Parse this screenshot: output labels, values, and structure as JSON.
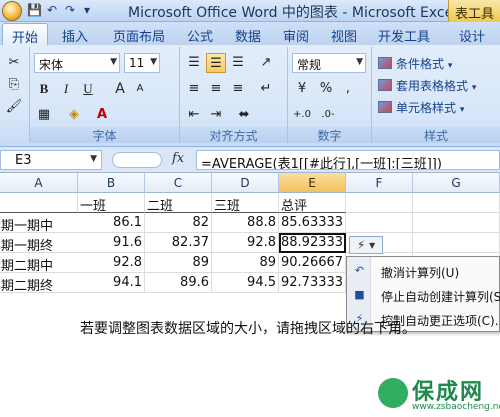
{
  "window": {
    "title": "Microsoft Office Word 中的图表 - Microsoft Excel",
    "context_tab": "表工具"
  },
  "qat": {
    "save": "💾",
    "undo": "↶",
    "redo": "↷",
    "customize": "▾"
  },
  "tabs": [
    "开始",
    "插入",
    "页面布局",
    "公式",
    "数据",
    "审阅",
    "视图",
    "开发工具",
    "设计"
  ],
  "ribbon": {
    "font": {
      "name": "宋体",
      "size": "11",
      "bold": "B",
      "italic": "I",
      "underline": "U",
      "grow": "A",
      "shrink": "A",
      "group_label": "字体"
    },
    "alignment": {
      "group_label": "对齐方式"
    },
    "number": {
      "format": "常规",
      "percent": "%",
      "comma": ",",
      "group_label": "数字"
    },
    "styles": {
      "conditional": "条件格式",
      "table_format": "套用表格格式",
      "cell_styles": "单元格样式",
      "group_label": "样式"
    }
  },
  "formula_bar": {
    "name_box": "E3",
    "fx": "fx",
    "formula": "=AVERAGE(表1[[#此行],[一班]:[三班]])"
  },
  "grid": {
    "columns": [
      "A",
      "B",
      "C",
      "D",
      "E",
      "F",
      "G"
    ],
    "header_row": [
      "一班",
      "二班",
      "三班",
      "总评"
    ],
    "rows": [
      {
        "label": "学期一期中",
        "values": [
          "86.1",
          "82",
          "88.8",
          "85.63333"
        ]
      },
      {
        "label": "学期一期终",
        "values": [
          "91.6",
          "82.37",
          "92.8",
          "88.92333"
        ]
      },
      {
        "label": "学期二期中",
        "values": [
          "92.8",
          "89",
          "89",
          "90.26667"
        ]
      },
      {
        "label": "学期二期终",
        "values": [
          "94.1",
          "89.6",
          "94.5",
          "92.73333"
        ]
      }
    ]
  },
  "smart_tag": {
    "icon": "⚡",
    "arrow": "▾"
  },
  "context_menu": {
    "items": [
      {
        "label": "撤消计算列(U)",
        "icon": "undo-icon"
      },
      {
        "label": "停止自动创建计算列(S)",
        "icon": "stop-icon"
      },
      {
        "label": "控制自动更正选项(C)...",
        "icon": "autocorrect-icon"
      }
    ]
  },
  "tip": "若要调整图表数据区域的大小，请拖拽区域的右下角。",
  "watermark": {
    "name": "保成网",
    "url": "www.zsbaocheng.net"
  },
  "colors": {
    "ribbon": "#dbe7f8",
    "selection": "#f2c15a",
    "watermark": "#1e8a4d"
  }
}
